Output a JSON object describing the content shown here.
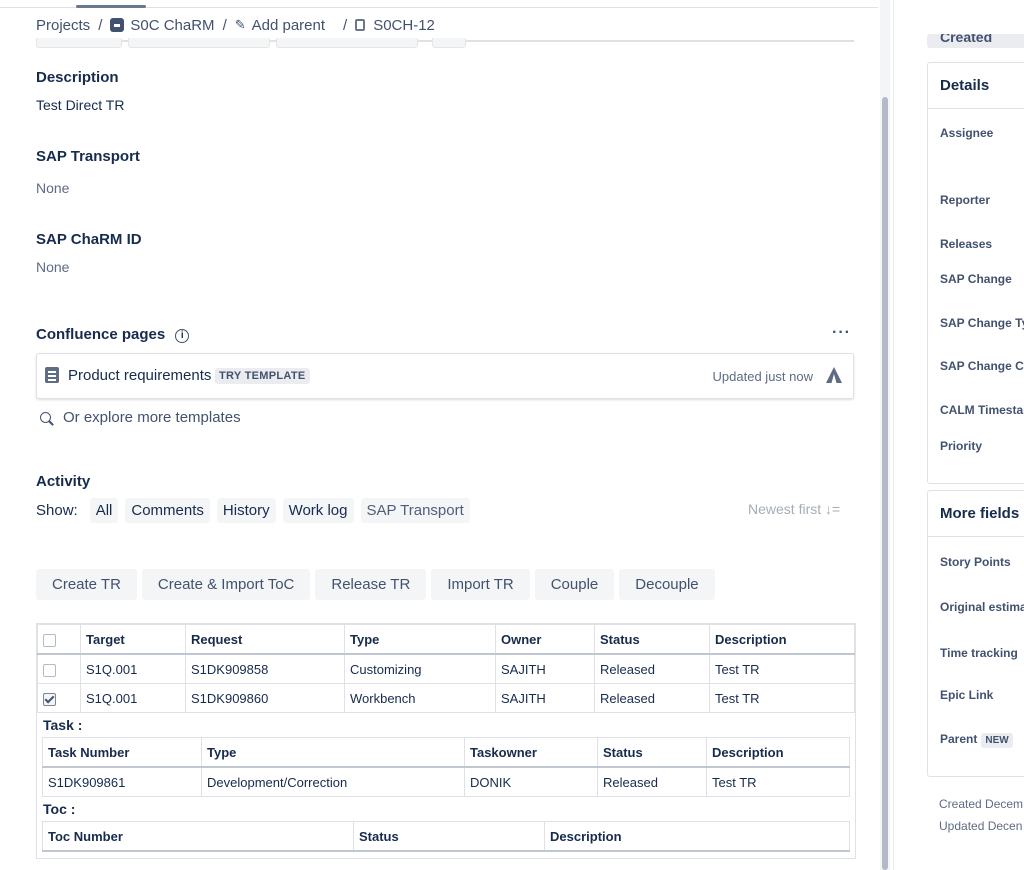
{
  "breadcrumb": {
    "projects": "Projects",
    "project": "S0C ChaRM",
    "add_parent": "Add parent",
    "issue": "S0CH-12"
  },
  "description": {
    "heading": "Description",
    "value": "Test Direct TR"
  },
  "sap_transport": {
    "heading": "SAP Transport",
    "value": "None"
  },
  "sap_charm_id": {
    "heading": "SAP ChaRM ID",
    "value": "None"
  },
  "confluence": {
    "heading": "Confluence pages",
    "more": "···",
    "item_title": "Product requirements",
    "item_badge": "TRY TEMPLATE",
    "item_updated": "Updated just now",
    "explore": "Or explore more templates"
  },
  "activity": {
    "heading": "Activity",
    "show_label": "Show:",
    "filters": [
      "All",
      "Comments",
      "History",
      "Work log",
      "SAP Transport"
    ],
    "sort": "Newest first ↓="
  },
  "actions": [
    "Create TR",
    "Create & Import ToC",
    "Release TR",
    "Import TR",
    "Couple",
    "Decouple"
  ],
  "transport_table": {
    "columns": [
      "Target",
      "Request",
      "Type",
      "Owner",
      "Status",
      "Description"
    ],
    "rows": [
      {
        "checked": false,
        "target": "S1Q.001",
        "request": "S1DK909858",
        "type": "Customizing",
        "owner": "SAJITH",
        "status": "Released",
        "description": "Test TR"
      },
      {
        "checked": true,
        "target": "S1Q.001",
        "request": "S1DK909860",
        "type": "Workbench",
        "owner": "SAJITH",
        "status": "Released",
        "description": "Test TR"
      }
    ]
  },
  "task_section": {
    "label": "Task :",
    "columns": [
      "Task Number",
      "Type",
      "Taskowner",
      "Status",
      "Description"
    ],
    "row": {
      "number": "S1DK909861",
      "type": "Development/Correction",
      "owner": "DONIK",
      "status": "Released",
      "description": "Test TR"
    }
  },
  "toc_section": {
    "label": "Toc :",
    "columns": [
      "Toc Number",
      "Status",
      "Description"
    ]
  },
  "right_panel": {
    "status_button": "Created",
    "details_heading": "Details",
    "details_fields": [
      "Assignee",
      "Reporter",
      "Releases",
      "SAP Change",
      "SAP Change Ty",
      "SAP Change Cy",
      "CALM Timestar",
      "Priority"
    ],
    "more_heading": "More fields",
    "more_fields": [
      "Story Points",
      "Original estima",
      "Time tracking",
      "Epic Link",
      "Parent"
    ],
    "parent_badge": "NEW",
    "created": "Created Decem",
    "updated": "Updated Decen"
  }
}
